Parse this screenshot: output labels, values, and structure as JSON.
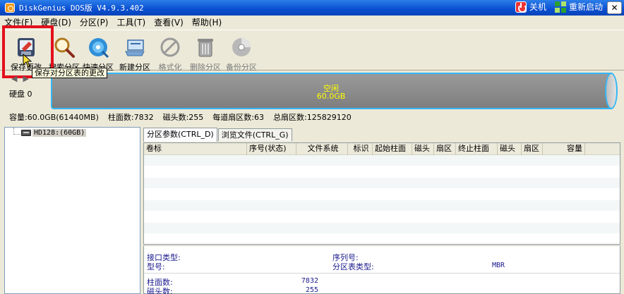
{
  "window": {
    "title": "DiskGenius DOS版 V4.9.3.402",
    "shutdown_label": "关机",
    "restart_label": "重新启动",
    "close_glyph": "✕"
  },
  "menu": [
    "文件(F)",
    "硬盘(D)",
    "分区(P)",
    "工具(T)",
    "查看(V)",
    "帮助(H)"
  ],
  "toolbar": {
    "items": [
      {
        "label": "保存更改",
        "icon": "save-disk-icon",
        "enabled": true
      },
      {
        "label": "搜索分区",
        "icon": "magnifier-icon",
        "enabled": true
      },
      {
        "label": "快速分区",
        "icon": "quick-partition-icon",
        "enabled": true
      },
      {
        "label": "新建分区",
        "icon": "new-partition-icon",
        "enabled": true
      },
      {
        "label": "格式化",
        "icon": "format-icon",
        "enabled": false
      },
      {
        "label": "删除分区",
        "icon": "trash-icon",
        "enabled": false
      },
      {
        "label": "备份分区",
        "icon": "backup-disc-icon",
        "enabled": false
      }
    ],
    "tooltip": "保存对分区表的更改"
  },
  "diskbar": {
    "disk_label": "硬盘 0",
    "segment_name": "空闲",
    "segment_size": "60.0GB",
    "accent_color": "#33b7f5",
    "segment_text_color": "#ffff00"
  },
  "info": {
    "capacity": "容量:60.0GB(61440MB)",
    "cylinders": "柱面数:7832",
    "heads": "磁头数:255",
    "sectors_per_track": "每道扇区数:63",
    "total_sectors": "总扇区数:125829120"
  },
  "tree": {
    "disk_label": "HD128:(60GB)"
  },
  "tabs": [
    "分区参数(CTRL_D)",
    "浏览文件(CTRL_G)"
  ],
  "table": {
    "columns": [
      "卷标",
      "序号(状态)",
      "文件系统",
      "标识",
      "起始柱面",
      "磁头",
      "扇区",
      "终止柱面",
      "磁头",
      "扇区",
      "容量"
    ]
  },
  "details": {
    "interface_type_label": "接口类型:",
    "model_label": "型号:",
    "serial_label": "序列号:",
    "partition_table_type_label": "分区表类型:",
    "partition_table_type_value": "MBR",
    "cylinders_label": "柱面数:",
    "cylinders_value": "7832",
    "heads_label": "磁头数:",
    "heads_value": "255"
  }
}
